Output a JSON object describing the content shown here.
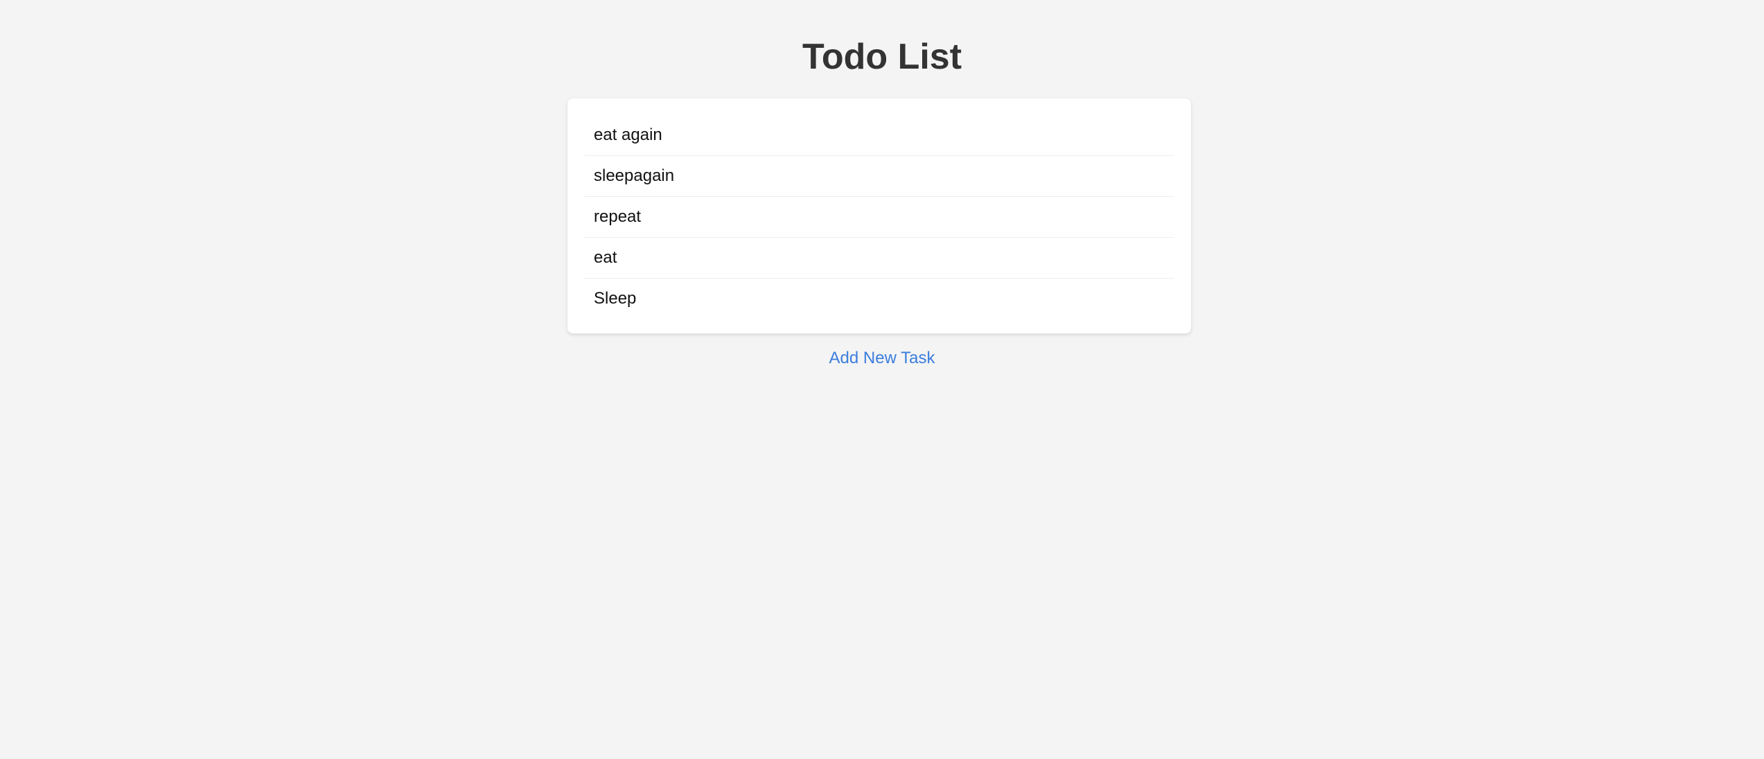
{
  "header": {
    "title": "Todo List"
  },
  "tasks": [
    {
      "label": "eat again"
    },
    {
      "label": "sleepagain"
    },
    {
      "label": "repeat"
    },
    {
      "label": "eat"
    },
    {
      "label": "Sleep"
    }
  ],
  "actions": {
    "add_label": "Add New Task"
  },
  "colors": {
    "background": "#f4f4f4",
    "card": "#ffffff",
    "title": "#333333",
    "link": "#3b7ddd"
  }
}
